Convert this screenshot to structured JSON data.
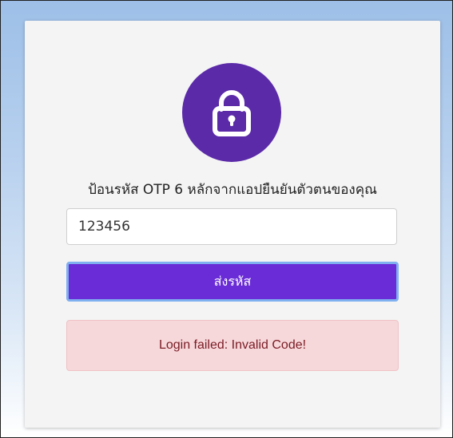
{
  "login_card": {
    "icon": "lock-icon",
    "prompt": "ป้อนรหัส OTP 6 หลักจากแอปยืนยันตัวตนของคุณ",
    "otp_input": {
      "value": "123456",
      "placeholder": ""
    },
    "submit_label": "ส่งรหัส",
    "error_message": "Login failed: Invalid Code!"
  },
  "colors": {
    "accent": "#5b2aa8",
    "button": "#6a2cd6",
    "error_bg": "#f6d7da",
    "error_text": "#7a1c24"
  }
}
